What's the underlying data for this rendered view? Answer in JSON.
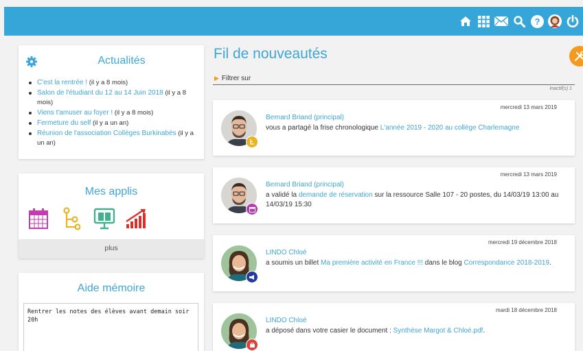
{
  "topbar": {
    "icons": [
      "home-icon",
      "apps-grid-icon",
      "mail-icon",
      "search-icon",
      "help-icon",
      "user-avatar",
      "power-icon"
    ],
    "accent": "#36a6d8"
  },
  "news": {
    "title": "Actualités",
    "items": [
      {
        "link": "C'est la rentrée !",
        "meta": " (il y a 8 mois)"
      },
      {
        "link": "Salon de l'étudiant du 12 au 14 Juin 2018",
        "meta": " (il y a 8 mois)"
      },
      {
        "link": "Viens t'amuser au foyer !",
        "meta": " (il y a 8 mois)"
      },
      {
        "link": "Fermeture du self",
        "meta": " (il y a un an)"
      },
      {
        "link": "Réunion de l'association Collèges Burkinabés",
        "meta": " (il y a un an)"
      }
    ]
  },
  "apps": {
    "title": "Mes applis",
    "icons": [
      "calendar-app-icon",
      "timeline-app-icon",
      "collaborative-wall-app-icon",
      "statistics-app-icon"
    ],
    "more_label": "plus"
  },
  "memo": {
    "title": "Aide mémoire",
    "text": "Rentrer les notes des élèves avant demain soir 20h"
  },
  "feed": {
    "title": "Fil de nouveautés",
    "filter_label": "Filtrer sur",
    "inactive_label": "Inactif(s) 1",
    "posts": [
      {
        "date": "mercredi 13 mars 2019",
        "author": "Bernard Briand (principal)",
        "text_before": "vous a partagé la frise chronologique ",
        "link1": "L'année 2019 - 2020 au collège Charlemagne",
        "text_middle": "",
        "link2": "",
        "text_after": "",
        "badge_color": "#e8b522"
      },
      {
        "date": "mercredi 13 mars 2019",
        "author": "Bernard Briand (principal)",
        "text_before": "a validé la ",
        "link1": "demande de réservation",
        "text_middle": "  sur la ressource Salle 107 - 20 postes,  du 14/03/19 13:00 au 14/03/19 15:30",
        "link2": "",
        "text_after": "",
        "badge_color": "#b93ab4"
      },
      {
        "date": "mercredi 19 décembre 2018",
        "author": "LINDO Chloé",
        "text_before": "a soumis un billet ",
        "link1": "Ma première activité en France !!!",
        "text_middle": " dans le blog ",
        "link2": "Correspondance 2018-2019",
        "text_after": ".",
        "badge_color": "#243a9c"
      },
      {
        "date": "mardi 18 décembre 2018",
        "author": "LINDO Chloé",
        "text_before": "a déposé dans votre casier le document : ",
        "link1": "Synthèse Margot & Chloé.pdf",
        "text_middle": ".",
        "link2": "",
        "text_after": "",
        "badge_color": "#e0403a"
      }
    ]
  }
}
